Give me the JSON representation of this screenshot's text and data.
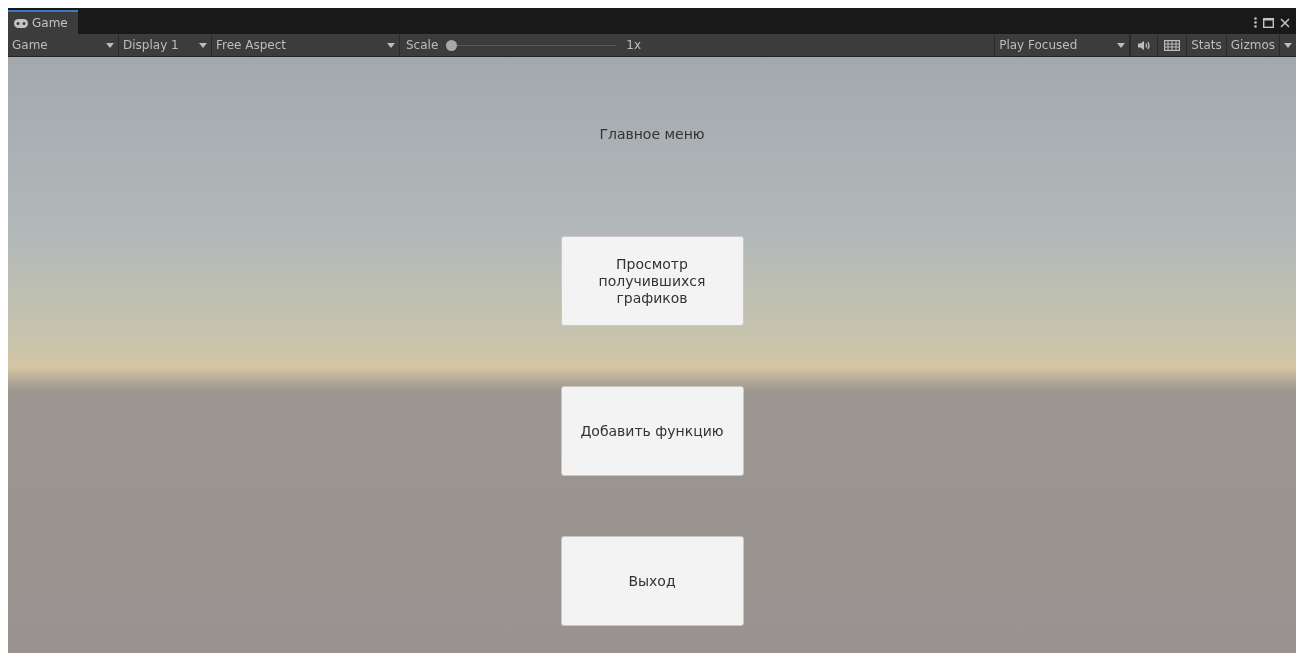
{
  "window": {
    "tab": {
      "label": "Game",
      "selected": true
    }
  },
  "toolbar": {
    "view_mode": "Game",
    "display": "Display 1",
    "aspect": "Free Aspect",
    "scale": {
      "label": "Scale",
      "level": 0,
      "reading": "1x"
    },
    "play_mode": "Play Focused",
    "stats": "Stats",
    "gizmos": "Gizmos"
  },
  "game": {
    "title": "Главное меню",
    "buttons": [
      "Просмотр получившихся графиков",
      "Добавить функцию",
      "Выход"
    ]
  }
}
